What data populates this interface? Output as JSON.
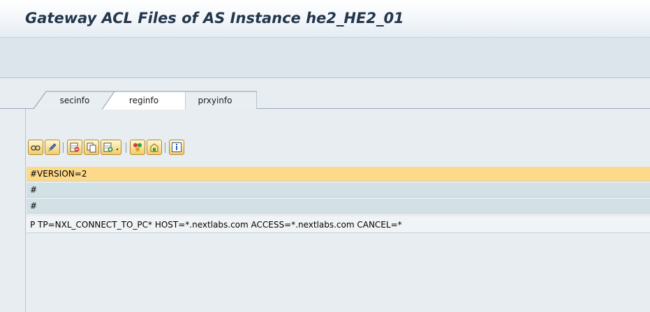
{
  "window": {
    "title": "Gateway ACL Files of AS Instance he2_HE2_01"
  },
  "tabs": [
    {
      "label": "secinfo",
      "active": false
    },
    {
      "label": "reginfo",
      "active": true
    },
    {
      "label": "prxyinfo",
      "active": false
    }
  ],
  "toolbar": {
    "buttons": [
      {
        "name": "display-icon"
      },
      {
        "name": "edit-pencil-icon"
      },
      {
        "name": "delete-row-icon"
      },
      {
        "name": "copy-row-icon"
      },
      {
        "name": "insert-row-dropdown-icon"
      },
      {
        "name": "check-icon"
      },
      {
        "name": "activate-icon"
      },
      {
        "name": "info-icon"
      }
    ]
  },
  "lines": [
    "#VERSION=2",
    "#",
    "#",
    "P TP=NXL_CONNECT_TO_PC* HOST=*.nextlabs.com ACCESS=*.nextlabs.com CANCEL=*"
  ],
  "colors": {
    "title_text": "#23364c",
    "selected_row": "#fdd98a",
    "alt_row": "#d2e1e5",
    "button_gradient_top": "#fff8d6",
    "button_gradient_bottom": "#f1cd6a"
  }
}
